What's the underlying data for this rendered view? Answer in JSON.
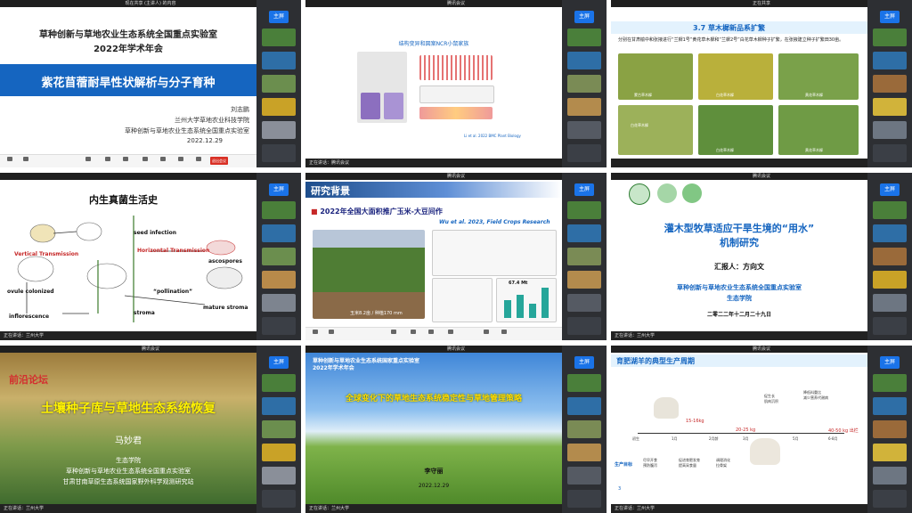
{
  "tiles": {
    "t1": {
      "window_title": "现在共享 (主讲人) 的内容",
      "meeting_title": "草种创新与草地农业生态系统全国重点实验室",
      "year_title": "2022年学术年会",
      "talk_title": "紫花苜蓿耐旱性状解析与分子育种",
      "speaker": "刘志鹏",
      "affil1": "兰州大学草地农业科技学院",
      "affil2": "草种创新与草地农业生态系统全国重点实验室",
      "date": "2022.12.29",
      "leave": "退出会议"
    },
    "t2": {
      "window_title": "腾讯会议",
      "figure_title": "结构变异和図案NCR小鼠家族",
      "citation": "Li et al. 2022 BMC Plant Biology",
      "bottom": "正在讲话：腾讯会议"
    },
    "t3": {
      "window_title": "正在共享",
      "heading": "3.7 草木樨新品系扩繁",
      "bullet": "分别在甘肃榆中和张掖进行“兰樨1号”黄花草木樨和“兰樨2号”白花草木樨种子扩繁，在张掖建立种子扩繁田30亩。",
      "cap_a": "蒙古草木樨",
      "cap_b": "白花草木樨",
      "cap_c": "白花草木樨",
      "cap_d": "黄花草木樨",
      "cap_e": "白花草木樨",
      "cap_f": "黄花草木樨",
      "side_btn": "主屏"
    },
    "t4": {
      "title": "内生真菌生活史",
      "seed_infection": "seed infection",
      "vertical": "Vertical Transmission",
      "horizontal": "Horizontal Transmission",
      "ascospores": "ascospores",
      "pollination": "“pollination”",
      "ovule": "ovule colonized",
      "inflorescence": "inflorescence",
      "stroma": "stroma",
      "mature": "mature stroma",
      "bottom": "正在讲话：兰州大学"
    },
    "t5": {
      "window_title": "腾讯会议",
      "section": "研究背景",
      "subtitle": "2022年全国大面积推广玉米-大豆间作",
      "citation": "Wu et al. 2023, Field Crops Research",
      "photo_caption": "玉米8.2亩 / 种植170 mm",
      "chart_label": "67.4 Mt"
    },
    "t6": {
      "window_title": "腾讯会议",
      "title_line1": "灌木型牧草适应干旱生境的“用水”",
      "title_line2": "机制研究",
      "reporter": "汇报人：方向文",
      "lab": "草种创新与草地农业生态系统全国重点实验室",
      "college": "生态学院",
      "date": "二零二二年十二月二十九日",
      "bottom": "正在讲话：兰州大学"
    },
    "t7": {
      "window_title": "腾讯会议",
      "forum": "前沿论坛",
      "talk": "土壤种子库与草地生态系统恢复",
      "speaker": "马妙君",
      "college": "生态学院",
      "lab": "草种创新与草地农业生态系统全国重点实验室",
      "station": "甘肃甘南草原生态系统国家野外科学观测研究站",
      "bottom": "正在讲话：兰州大学"
    },
    "t8": {
      "window_title": "腾讯会议",
      "header1": "草种创新与草地农业生态系统国家重点实验室",
      "header2": "2022年学术年会",
      "talk": "全球变化下的草地生态系统稳定性与草地管理策略",
      "speaker": "李守丽",
      "date": "2022.12.29",
      "bottom": "正在讲话：兰州大学"
    },
    "t9": {
      "window_title": "腾讯会议",
      "title": "育肥湖羊的典型生产周期",
      "stage_labels": [
        "初生",
        "1月",
        "2月龄",
        "3月",
        "5月",
        "6-8月"
      ],
      "weights": [
        "15-16kg",
        "20-25 kg",
        "40-50 kg"
      ],
      "weights_suffix": "出栏",
      "goal_label": "生产目标",
      "goals": [
        "尽早开食\n预防腹泻",
        "促进育肥发育\n提高采食量",
        "调理消化\n拉骨架"
      ],
      "top_notes": [
        "促生长\n肌肉沉积",
        "降低料重比\n减少营养代谢病"
      ],
      "page": "3",
      "bottom": "正在讲话：兰州大学"
    }
  },
  "side_button_label": "主屏",
  "participant_names": [
    "兰州大学",
    "兰州大学",
    "兰州大学",
    "兰州大学",
    "兰州大学",
    "兰州大学"
  ],
  "colors": {
    "header_blue": "#1565c0",
    "accent_red": "#d32f2f",
    "leave_red": "#d93025",
    "side_btn_blue": "#1a73e8"
  }
}
